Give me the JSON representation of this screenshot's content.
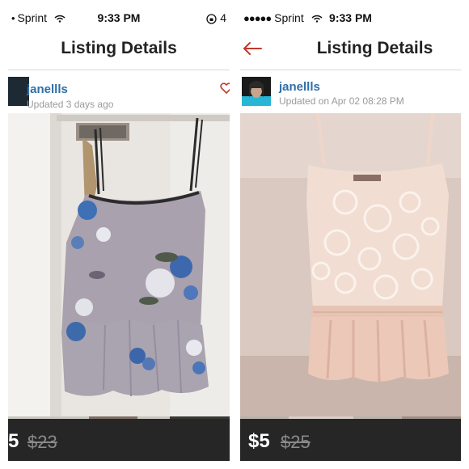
{
  "left": {
    "status": {
      "carrier": "Sprint",
      "time": "9:33 PM",
      "right": "4"
    },
    "nav_title": "Listing Details",
    "username": "janellls",
    "updated": "Updated 3 days ago",
    "price": "5",
    "original_price": "$23"
  },
  "right": {
    "status": {
      "carrier": "Sprint",
      "time": "9:33 PM"
    },
    "nav_title": "Listing Details",
    "username": "janellls",
    "updated": "Updated on Apr 02 08:28 PM",
    "price": "$5",
    "original_price": "$25"
  },
  "colors": {
    "accent_red": "#c0392b",
    "username_blue": "#2f6fa8",
    "price_bar": "#262626"
  }
}
